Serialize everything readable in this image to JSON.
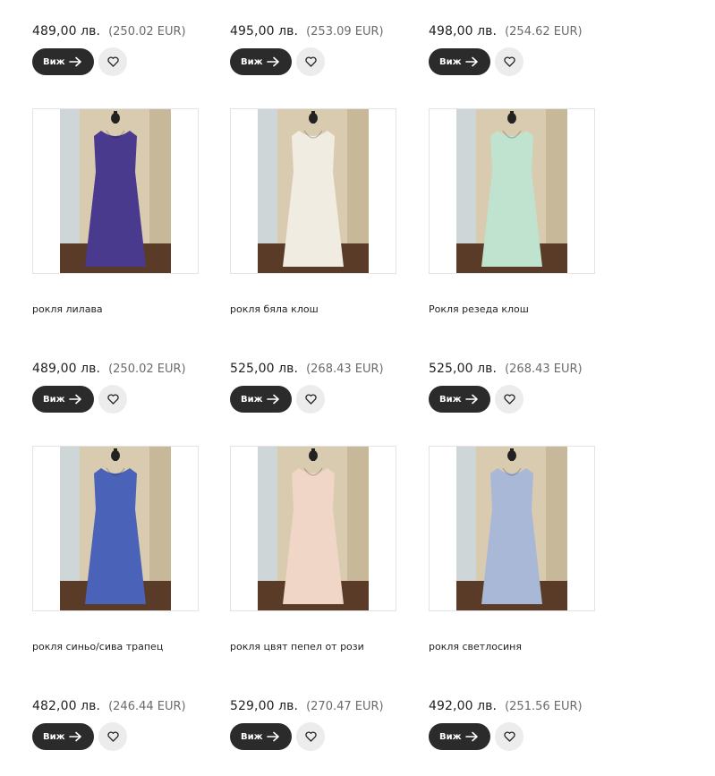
{
  "buttons": {
    "view_label": "Виж"
  },
  "icons": {
    "view_arrow": "arrow-right-icon",
    "favorite": "heart-icon"
  },
  "top_row": [
    {
      "price": "489,00 лв.",
      "price_eur": "(250.02 EUR)"
    },
    {
      "price": "495,00 лв.",
      "price_eur": "(253.09 EUR)"
    },
    {
      "price": "498,00 лв.",
      "price_eur": "(254.62 EUR)"
    }
  ],
  "products": [
    {
      "title": "рокля лилава",
      "price": "489,00 лв.",
      "price_eur": "(250.02 EUR)",
      "dress_color": "#4a3a8e"
    },
    {
      "title": "рокля бяла клош",
      "price": "525,00 лв.",
      "price_eur": "(268.43 EUR)",
      "dress_color": "#f1ece2"
    },
    {
      "title": "Рокля резеда клош",
      "price": "525,00 лв.",
      "price_eur": "(268.43 EUR)",
      "dress_color": "#bfe3cf"
    },
    {
      "title": "рокля синьо/сива трапец",
      "price": "482,00 лв.",
      "price_eur": "(246.44 EUR)",
      "dress_color": "#4a63b8"
    },
    {
      "title": "рокля цвят пепел от рози",
      "price": "529,00 лв.",
      "price_eur": "(270.47 EUR)",
      "dress_color": "#efd6c6"
    },
    {
      "title": "рокля светлосиня",
      "price": "492,00 лв.",
      "price_eur": "(251.56 EUR)",
      "dress_color": "#a9b8d6"
    }
  ]
}
